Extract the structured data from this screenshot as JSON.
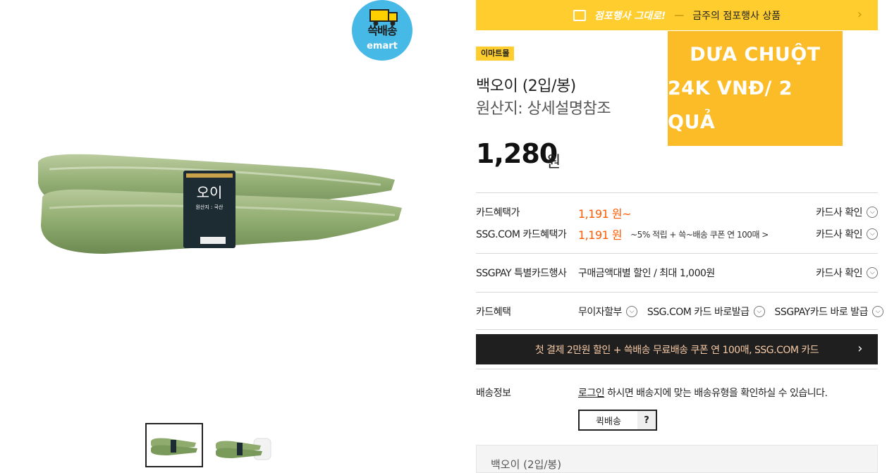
{
  "badge": {
    "line1": "쓱배송",
    "line2": "emart"
  },
  "product_label": {
    "name": "오이",
    "origin": "원산지 : 국산"
  },
  "promo_bar": {
    "left": "점포행사 그대로!",
    "separator": "—",
    "right": "금주의 점포행사 상품"
  },
  "store_tag": "이마트몰",
  "product": {
    "title": "백오이 (2입/봉)",
    "origin": "원산지: 상세설명참조",
    "price": "1,280",
    "price_unit": "원"
  },
  "overlay": {
    "line1": "DƯA CHUỘT",
    "line2": "24K VNĐ/ 2 QUẢ"
  },
  "card_benefit": {
    "label": "카드혜택가",
    "value": "1,191 원~",
    "check": "카드사 확인"
  },
  "ssg_card_benefit": {
    "label": "SSG.COM 카드혜택가",
    "value": "1,191 원",
    "note": "~5% 적립 + 쓱~배송 쿠폰 연 100매 >",
    "check": "카드사 확인"
  },
  "ssgpay": {
    "label": "SSGPAY 특별카드행사",
    "value": "구매금액대별 할인 / 최대 1,000원",
    "check": "카드사 확인"
  },
  "card_perks": {
    "label": "카드혜택",
    "items": [
      "무이자할부",
      "SSG.COM 카드 바로발급",
      "SSGPAY카드 바로 발급"
    ]
  },
  "banner": "첫 결제 2만원 할인 + 쓱배송 무료배송 쿠폰 연 100매, SSG.COM 카드",
  "delivery": {
    "label": "배송정보",
    "login": "로그인",
    "text": " 하시면 배송지에 맞는 배송유형을 확인하실 수 있습니다.",
    "quick": "퀵배송",
    "help": "?"
  },
  "bottom_title": "백오이 (2입/봉)",
  "colors": {
    "accent": "#ffce2e",
    "overlay": "#fcbc28",
    "price_red": "#ff5a00",
    "banner_bg": "#1f1f1f"
  }
}
